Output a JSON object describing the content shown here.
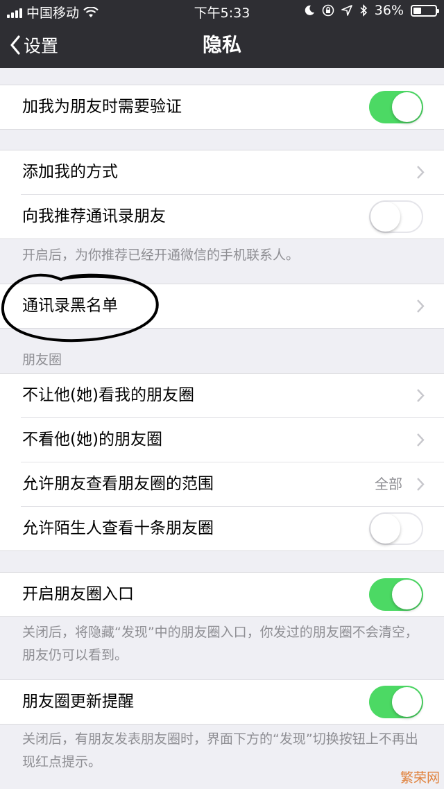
{
  "status_bar": {
    "carrier": "中国移动",
    "time": "下午5:33",
    "battery_text": "36%",
    "battery_level": 0.36,
    "icons": [
      "signal-icon",
      "wifi-icon",
      "moon-icon",
      "orientation-lock-icon",
      "location-icon",
      "bluetooth-icon",
      "battery-icon"
    ]
  },
  "nav": {
    "back_label": "设置",
    "title": "隐私"
  },
  "colors": {
    "toggle_on": "#4cd964",
    "nav_background": "#2e2e33",
    "page_background": "#efeff4",
    "annotation": "#000000"
  },
  "groups": {
    "g1": {
      "verify": {
        "label": "加我为朋友时需要验证",
        "on": true
      }
    },
    "g2": {
      "add_methods": {
        "label": "添加我的方式"
      },
      "recommend_contacts": {
        "label": "向我推荐通讯录朋友",
        "on": false
      },
      "footer": "开启后，为你推荐已经开通微信的手机联系人。"
    },
    "g3": {
      "blacklist": {
        "label": "通讯录黑名单"
      }
    },
    "moments": {
      "header": "朋友圈",
      "hide_from": {
        "label": "不让他(她)看我的朋友圈"
      },
      "dont_see": {
        "label": "不看他(她)的朋友圈"
      },
      "range": {
        "label": "允许朋友查看朋友圈的范围",
        "value": "全部"
      },
      "strangers": {
        "label": "允许陌生人查看十条朋友圈",
        "on": false
      }
    },
    "g5": {
      "entry": {
        "label": "开启朋友圈入口",
        "on": true
      },
      "footer": "关闭后，将隐藏“发现”中的朋友圈入口，你发过的朋友圈不会清空，朋友仍可以看到。"
    },
    "g6": {
      "updates": {
        "label": "朋友圈更新提醒",
        "on": true
      },
      "footer": "关闭后，有朋友发表朋友圈时，界面下方的“发现”切换按钮上不再出现红点提示。"
    }
  },
  "watermark": "繁荣网"
}
